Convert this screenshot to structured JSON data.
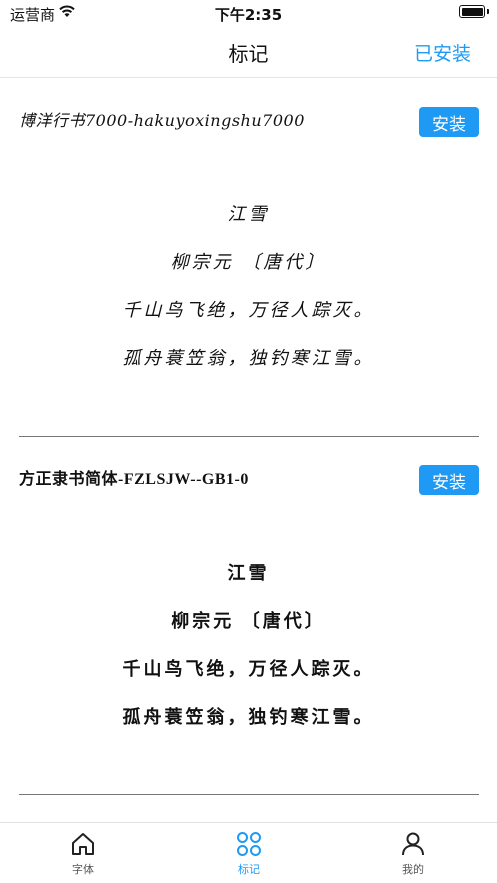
{
  "status_bar": {
    "carrier": "运营商",
    "time": "下午2:35"
  },
  "nav": {
    "title": "标记",
    "right_action": "已安装"
  },
  "fonts": [
    {
      "name": "博洋行书7000-hakuyoxingshu7000",
      "install_label": "安装",
      "poem": [
        "江雪",
        "柳宗元 〔唐代〕",
        "千山鸟飞绝，万径人踪灭。",
        "孤舟蓑笠翁，独钓寒江雪。"
      ]
    },
    {
      "name": "方正隶书简体-FZLSJW--GB1-0",
      "install_label": "安装",
      "poem": [
        "江雪",
        "柳宗元 〔唐代〕",
        "千山鸟飞绝，万径人踪灭。",
        "孤舟蓑笠翁，独钓寒江雪。"
      ]
    }
  ],
  "tabs": [
    {
      "label": "字体",
      "icon": "home-icon"
    },
    {
      "label": "标记",
      "icon": "grid-icon"
    },
    {
      "label": "我的",
      "icon": "user-icon"
    }
  ],
  "colors": {
    "accent": "#1e9af5"
  }
}
